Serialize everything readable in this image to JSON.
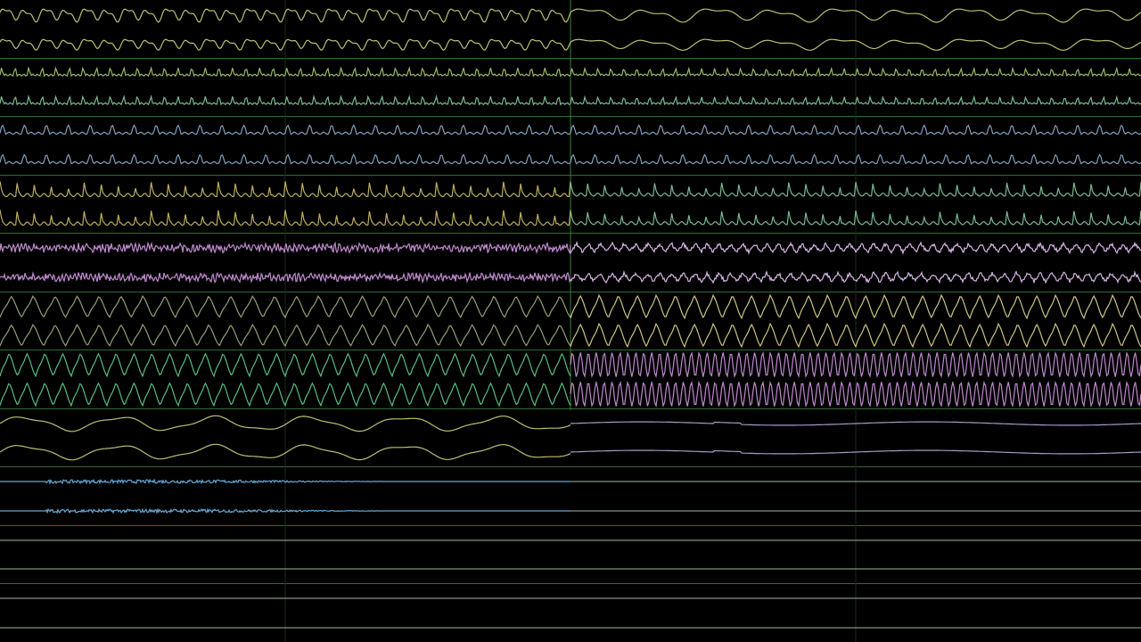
{
  "app": {
    "view": "oscilloscope",
    "columns": 2,
    "background": "#000000",
    "divider_color": "#3f8f3f"
  },
  "columns": [
    {
      "channels": [
        {
          "color": "#c8c878",
          "kind": "soft",
          "amp": 0.55,
          "cycles": 28,
          "active": true
        },
        {
          "color": "#c8c878",
          "kind": "soft",
          "amp": 0.45,
          "cycles": 28,
          "active": true
        },
        {
          "color": "#9ec36a",
          "kind": "pulse",
          "amp": 0.45,
          "cycles": 42,
          "active": true
        },
        {
          "color": "#7fc49a",
          "kind": "pulse",
          "amp": 0.45,
          "cycles": 42,
          "active": true
        },
        {
          "color": "#8aa8c8",
          "kind": "pulse",
          "amp": 0.5,
          "cycles": 26,
          "active": true
        },
        {
          "color": "#8aa8c8",
          "kind": "pulse",
          "amp": 0.5,
          "cycles": 26,
          "active": true
        },
        {
          "color": "#c8b860",
          "kind": "spike",
          "amp": 0.6,
          "cycles": 34,
          "active": true
        },
        {
          "color": "#c8b860",
          "kind": "spike",
          "amp": 0.6,
          "cycles": 34,
          "active": true
        },
        {
          "color": "#c890d8",
          "kind": "noise",
          "amp": 0.35,
          "cycles": 140,
          "active": true
        },
        {
          "color": "#c890d8",
          "kind": "noise",
          "amp": 0.35,
          "cycles": 140,
          "active": true
        },
        {
          "color": "#9aaa7a",
          "kind": "tri",
          "amp": 0.75,
          "cycles": 26,
          "active": true
        },
        {
          "color": "#9aaa7a",
          "kind": "tri",
          "amp": 0.75,
          "cycles": 26,
          "active": true
        },
        {
          "color": "#5cc88a",
          "kind": "tri",
          "amp": 0.8,
          "cycles": 32,
          "active": true
        },
        {
          "color": "#5cc88a",
          "kind": "tri",
          "amp": 0.8,
          "cycles": 32,
          "active": true
        },
        {
          "color": "#c8c878",
          "kind": "slow",
          "amp": 0.55,
          "cycles": 6,
          "active": true
        },
        {
          "color": "#c8c878",
          "kind": "slow",
          "amp": 0.55,
          "cycles": 6,
          "active": true
        },
        {
          "color": "#6ab0e0",
          "kind": "fade",
          "amp": 0.12,
          "cycles": 200,
          "active": true
        },
        {
          "color": "#6ab0e0",
          "kind": "fade",
          "amp": 0.12,
          "cycles": 200,
          "active": true
        },
        {
          "color": "#b8d8b8",
          "kind": "flat",
          "amp": 0,
          "cycles": 0,
          "active": false
        },
        {
          "color": "#b8d8b8",
          "kind": "flat",
          "amp": 0,
          "cycles": 0,
          "active": false
        },
        {
          "color": "#b8d8b8",
          "kind": "flat",
          "amp": 0,
          "cycles": 0,
          "active": false
        },
        {
          "color": "#b8d8b8",
          "kind": "flat",
          "amp": 0,
          "cycles": 0,
          "active": false
        }
      ]
    },
    {
      "channels": [
        {
          "color": "#c8c878",
          "kind": "soft",
          "amp": 0.55,
          "cycles": 9,
          "active": true
        },
        {
          "color": "#c8c878",
          "kind": "soft",
          "amp": 0.45,
          "cycles": 9,
          "active": true
        },
        {
          "color": "#9ec36a",
          "kind": "pulse",
          "amp": 0.4,
          "cycles": 44,
          "active": true
        },
        {
          "color": "#7fc49a",
          "kind": "pulse",
          "amp": 0.4,
          "cycles": 44,
          "active": true
        },
        {
          "color": "#8aa8c8",
          "kind": "pulse",
          "amp": 0.5,
          "cycles": 26,
          "active": true
        },
        {
          "color": "#8aa8c8",
          "kind": "pulse",
          "amp": 0.5,
          "cycles": 26,
          "active": true
        },
        {
          "color": "#7fc49a",
          "kind": "spike",
          "amp": 0.55,
          "cycles": 34,
          "active": true
        },
        {
          "color": "#7fc49a",
          "kind": "spike",
          "amp": 0.55,
          "cycles": 34,
          "active": true
        },
        {
          "color": "#e0c0f0",
          "kind": "buzz",
          "amp": 0.4,
          "cycles": 48,
          "active": true
        },
        {
          "color": "#e0c0f0",
          "kind": "buzz",
          "amp": 0.4,
          "cycles": 48,
          "active": true
        },
        {
          "color": "#d8d088",
          "kind": "tri",
          "amp": 0.8,
          "cycles": 30,
          "active": true
        },
        {
          "color": "#d8d088",
          "kind": "tri",
          "amp": 0.8,
          "cycles": 30,
          "active": true
        },
        {
          "color": "#c890d8",
          "kind": "sine",
          "amp": 0.85,
          "cycles": 72,
          "active": true
        },
        {
          "color": "#c890d8",
          "kind": "sine",
          "amp": 0.85,
          "cycles": 72,
          "active": true
        },
        {
          "color": "#b0a0d0",
          "kind": "drift",
          "amp": 0.2,
          "cycles": 2,
          "active": true
        },
        {
          "color": "#b0a0d0",
          "kind": "drift",
          "amp": 0.2,
          "cycles": 2,
          "active": true
        },
        {
          "color": "#b8d8b8",
          "kind": "flat",
          "amp": 0,
          "cycles": 0,
          "active": false
        },
        {
          "color": "#b8d8b8",
          "kind": "flat",
          "amp": 0,
          "cycles": 0,
          "active": false
        },
        {
          "color": "#b8d8b8",
          "kind": "flat",
          "amp": 0,
          "cycles": 0,
          "active": false
        },
        {
          "color": "#b8d8b8",
          "kind": "flat",
          "amp": 0,
          "cycles": 0,
          "active": false
        },
        {
          "color": "#b8d8b8",
          "kind": "flat",
          "amp": 0,
          "cycles": 0,
          "active": false
        },
        {
          "color": "#b8d8b8",
          "kind": "flat",
          "amp": 0,
          "cycles": 0,
          "active": false
        }
      ]
    }
  ]
}
